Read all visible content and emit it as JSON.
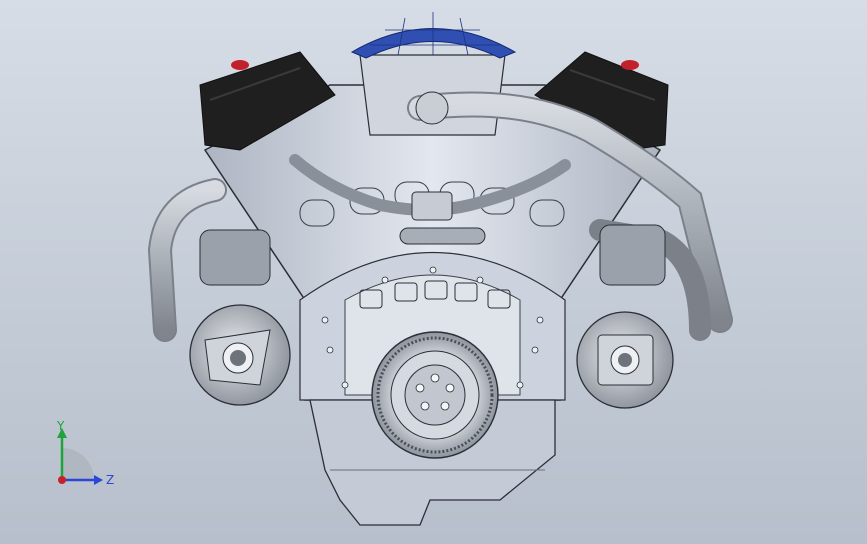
{
  "viewport": {
    "background_top": "#d7dde6",
    "background_bottom": "#b6bfcb"
  },
  "model": {
    "subject": "engine-assembly",
    "colors": {
      "body": "#cfd4de",
      "body_shadow": "#9aa2b0",
      "outline": "#2b2f36",
      "cap": "#1f1f1f",
      "cap_accent": "#c2202a",
      "intake_cover": "#2f4fb3",
      "pipe": "#b7bcc4",
      "pipe_shadow": "#7b8089"
    }
  },
  "triad": {
    "y_label": "Y",
    "z_label": "Z",
    "y_color": "#1fa33a",
    "z_color": "#2a47d6",
    "x_color": "#c8202a"
  }
}
